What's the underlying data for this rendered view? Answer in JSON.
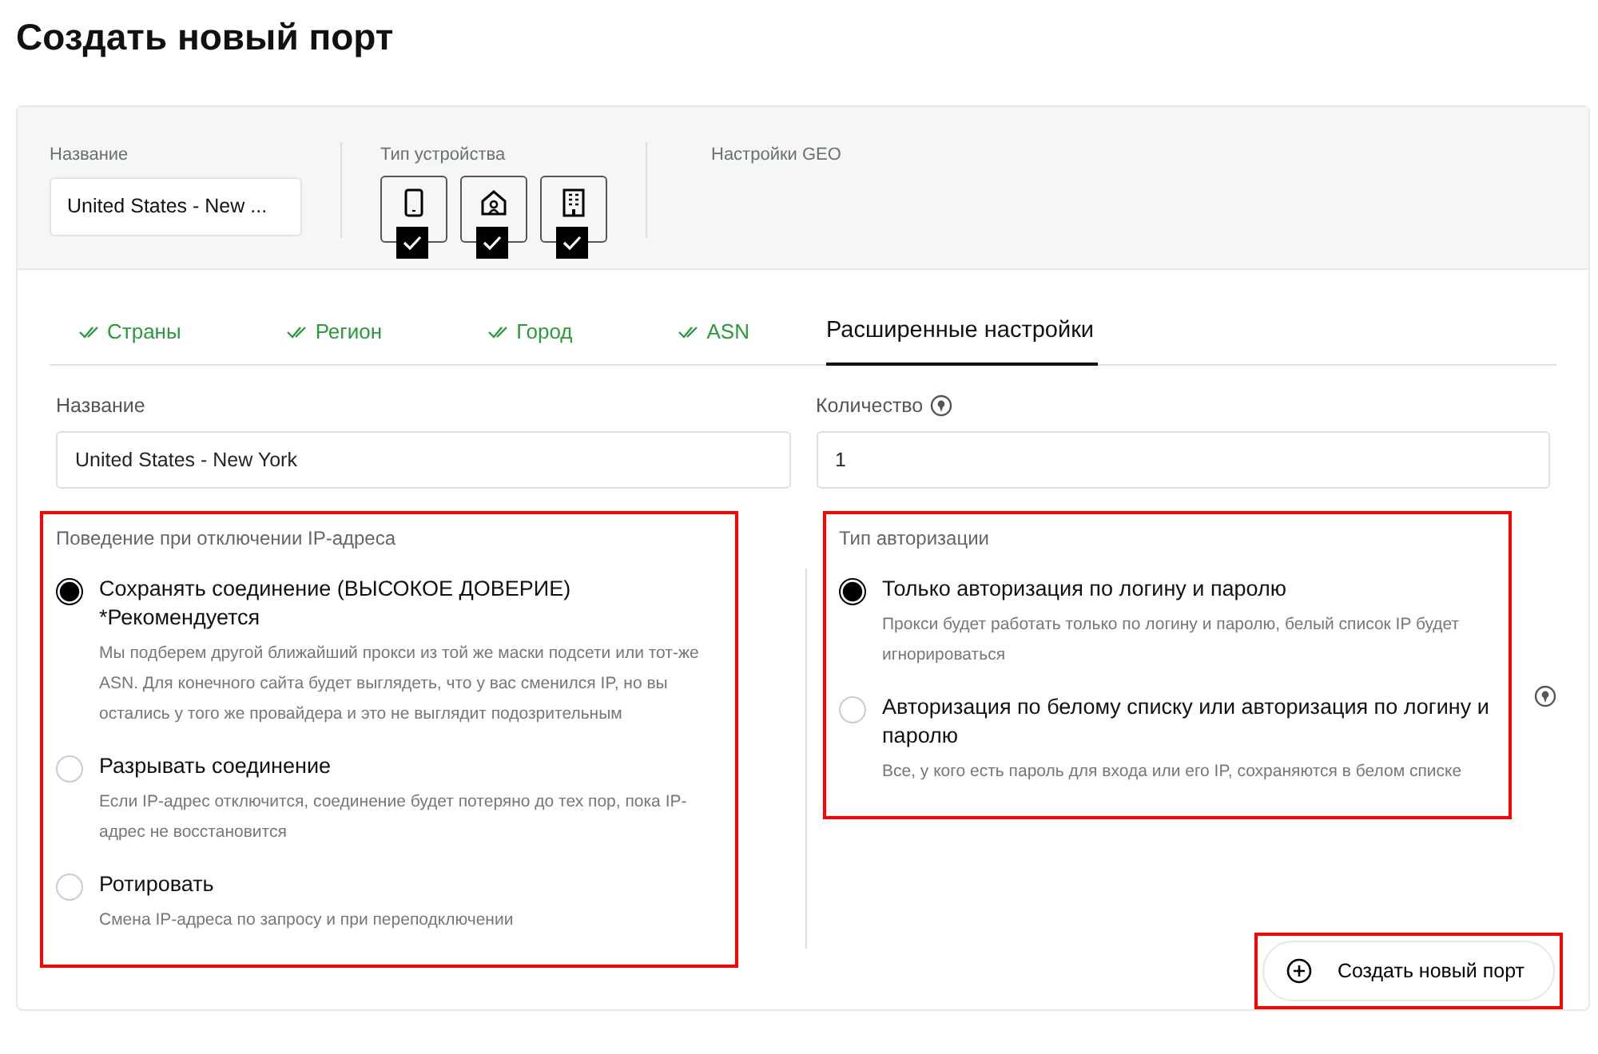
{
  "page_title": "Создать новый порт",
  "header": {
    "name_label": "Название",
    "name_value": "United States - New ...",
    "device_label": "Тип устройства",
    "devices": [
      {
        "kind": "phone",
        "checked": true
      },
      {
        "kind": "home",
        "checked": true
      },
      {
        "kind": "office",
        "checked": true
      }
    ],
    "geo_label": "Настройки GEO"
  },
  "tabs": [
    {
      "label": "Страны",
      "done": true,
      "selected": false
    },
    {
      "label": "Регион",
      "done": true,
      "selected": false
    },
    {
      "label": "Город",
      "done": true,
      "selected": false
    },
    {
      "label": "ASN",
      "done": true,
      "selected": false
    },
    {
      "label": "Расширенные настройки",
      "done": false,
      "selected": true
    }
  ],
  "fields": [
    {
      "label": "Название",
      "value": "United States - New York",
      "help": false
    },
    {
      "label": "Количество",
      "value": "1",
      "help": true
    }
  ],
  "disconnect": {
    "title": "Поведение при отключении IP-адреса",
    "highlighted": true,
    "options": [
      {
        "label": "Сохранять соединение (ВЫСОКОЕ ДОВЕРИЕ) *Рекомендуется",
        "description": "Мы подберем другой ближайший прокси из той же маски подсети или тот-же ASN. Для конечного сайта будет выглядеть, что у вас сменился IP, но вы остались у того же провайдера и это не выглядит подозрительным",
        "selected": true
      },
      {
        "label": "Разрывать соединение",
        "description": "Если IP-адрес отключится, соединение будет потеряно до тех пор, пока IP-адрес не восстановится",
        "selected": false
      },
      {
        "label": "Ротировать",
        "description": "Смена IP-адреса по запросу и при переподключении",
        "selected": false
      }
    ]
  },
  "auth": {
    "title": "Тип авторизации",
    "highlighted": true,
    "options": [
      {
        "label": "Только авторизация по логину и паролю",
        "description": "Прокси будет работать только по логину и паролю, белый список IP будет игнорироваться",
        "selected": true
      },
      {
        "label": "Авторизация по белому списку или авторизация по логину и паролю",
        "description": "Все, у кого есть пароль для входа или его IP, сохраняются в белом списке",
        "selected": false
      }
    ]
  },
  "submit": {
    "label": "Создать новый порт",
    "highlighted": true
  }
}
